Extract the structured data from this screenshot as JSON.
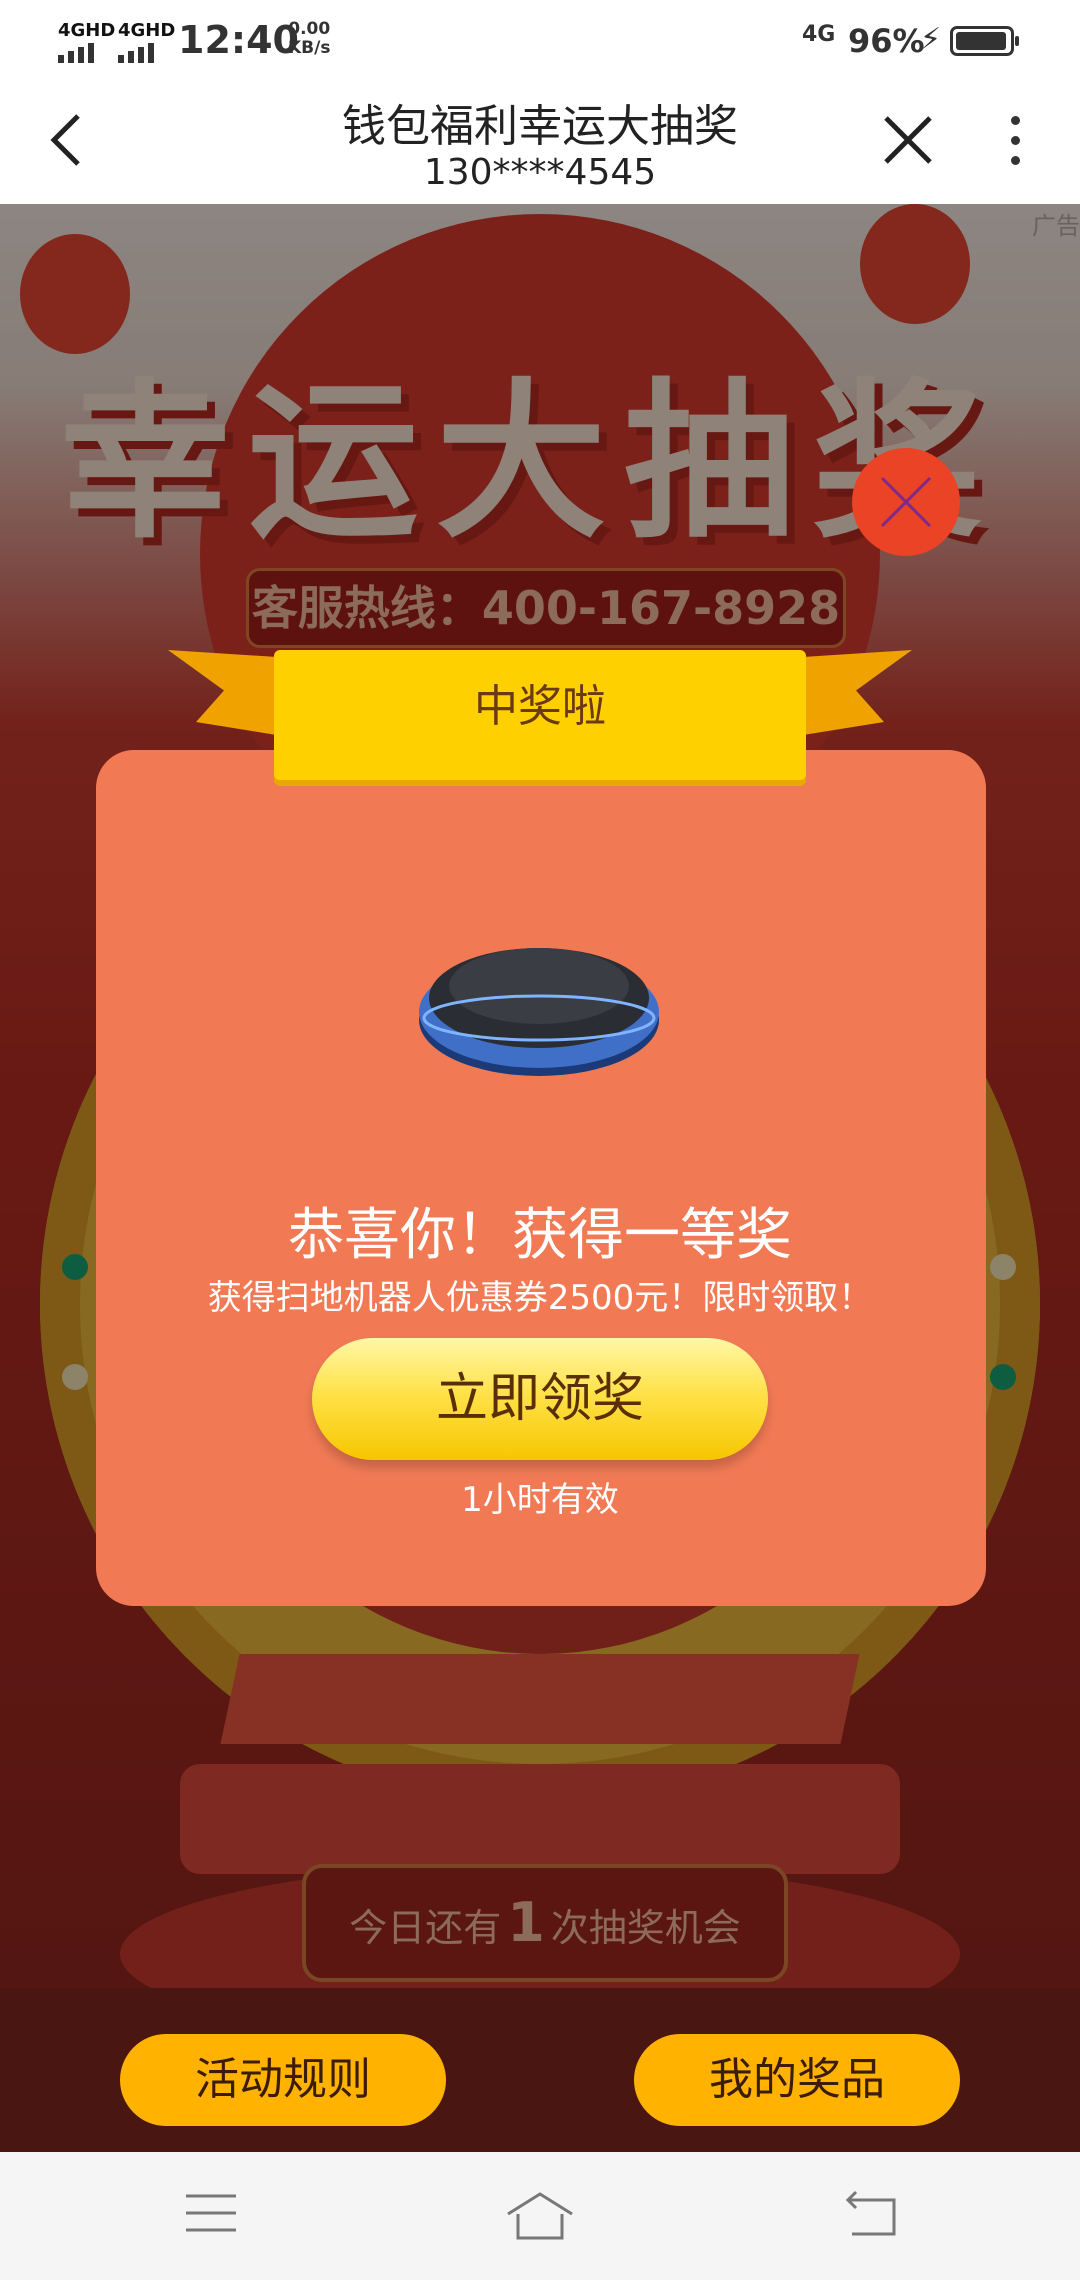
{
  "status_bar": {
    "signal_1": "4GHD",
    "signal_2": "4GHD",
    "time": "12:40",
    "speed_value": "0.00",
    "speed_unit": "KB/s",
    "network": "4G",
    "battery_percent": "96%",
    "battery_level": 0.96
  },
  "title_bar": {
    "title": "钱包福利幸运大抽奖",
    "subtitle": "130****4545"
  },
  "background": {
    "ad_label": "广告",
    "banner_title": "幸运大抽奖",
    "hotline": "客服热线：400-167-8928",
    "chances_prefix": "今日还有",
    "chances_count": "1",
    "chances_suffix": "次抽奖机会"
  },
  "dialog": {
    "ribbon_label": "中奖啦",
    "prize_image": "robot-vacuum",
    "congrats": "恭喜你！获得一等奖",
    "description": "获得扫地机器人优惠券2500元！限时领取！",
    "claim_button": "立即领奖",
    "validity": "1小时有效"
  },
  "actions": {
    "rules": "活动规则",
    "prizes": "我的奖品"
  },
  "icons": {
    "back": "chevron-left-icon",
    "close": "close-icon",
    "more": "more-vertical-icon",
    "dialog_close": "close-circle-icon",
    "nav_menu": "menu-icon",
    "nav_home": "home-icon",
    "nav_back": "back-icon"
  },
  "colors": {
    "dialog_bg": "#f17a55",
    "ribbon": "#ffd000",
    "button_yellow": "#ffe24a",
    "pill": "#ffb300",
    "close_circle": "#ea4325"
  }
}
